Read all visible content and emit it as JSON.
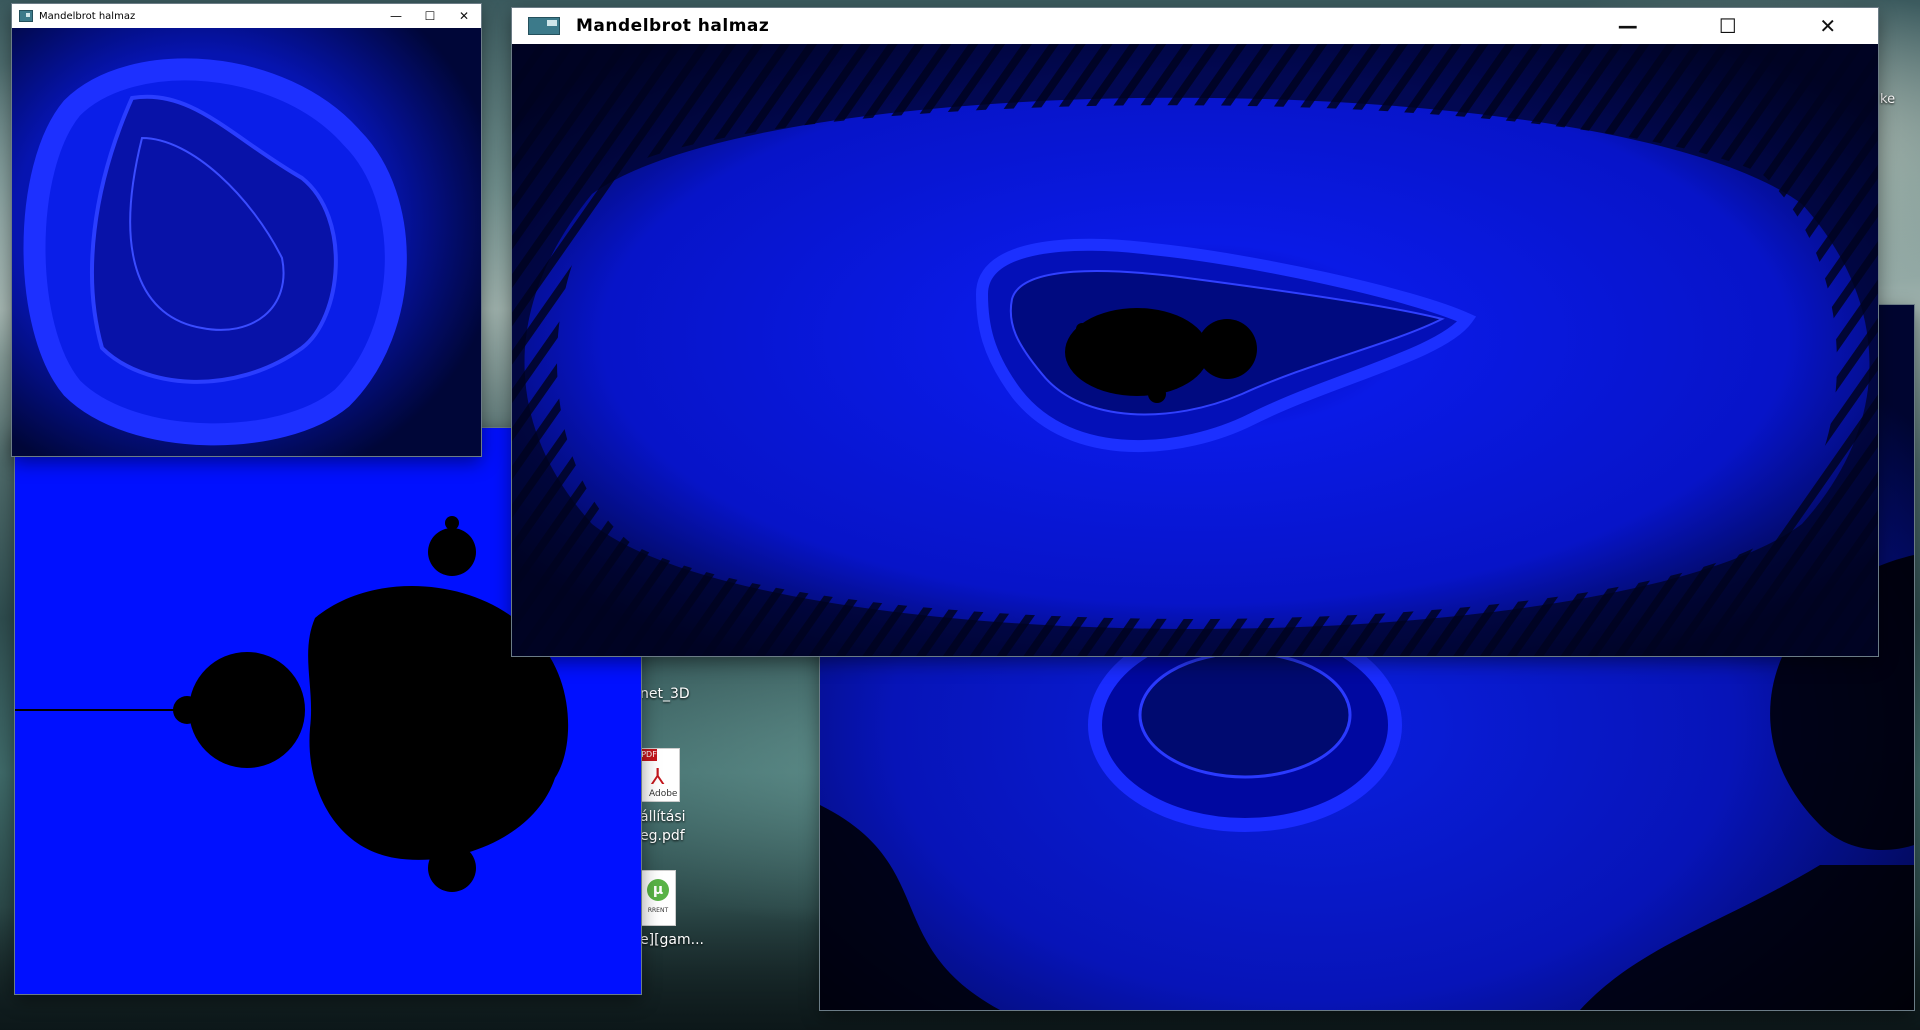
{
  "windows": {
    "small": {
      "title": "Mandelbrot halmaz",
      "buttons": {
        "minimize": "—",
        "maximize": "☐",
        "close": "✕"
      }
    },
    "main": {
      "title": "Mandelbrot halmaz",
      "buttons": {
        "minimize": "—",
        "maximize": "☐",
        "close": "✕"
      }
    }
  },
  "desktop": {
    "icons": [
      {
        "label_line1": "net_3D",
        "label_line2": ""
      },
      {
        "label_line1": "állítási",
        "label_line2": "eg.pdf",
        "badge": "PDF",
        "sub": "Adobe"
      },
      {
        "label_line1": "e][gam...",
        "label_line2": "",
        "sub": "RRENT"
      }
    ],
    "edge_text": "ke"
  },
  "colors": {
    "fractal_blue": "#0010ff",
    "deep_blue": "#000a60",
    "set_black": "#000000",
    "titlebar": "#ffffff"
  }
}
